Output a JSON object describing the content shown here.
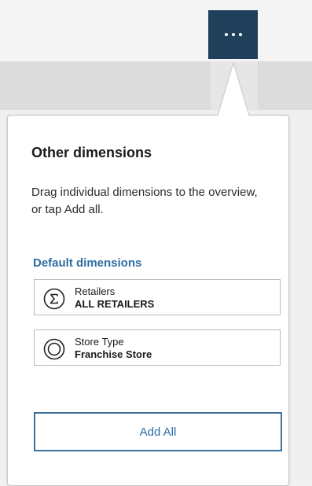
{
  "toolbar": {
    "more_icon": "more-horizontal-icon",
    "accent": "#1f3f5a"
  },
  "popover": {
    "title": "Other dimensions",
    "description": "Drag individual dimensions to the overview, or tap Add all.",
    "section_title": "Default dimensions",
    "dimensions": [
      {
        "name": "Retailers",
        "value": "ALL RETAILERS",
        "icon": "sigma-icon"
      },
      {
        "name": "Store Type",
        "value": "Franchise Store",
        "icon": "circle-icon"
      }
    ],
    "add_all_label": "Add All",
    "link_color": "#2e6da4"
  }
}
